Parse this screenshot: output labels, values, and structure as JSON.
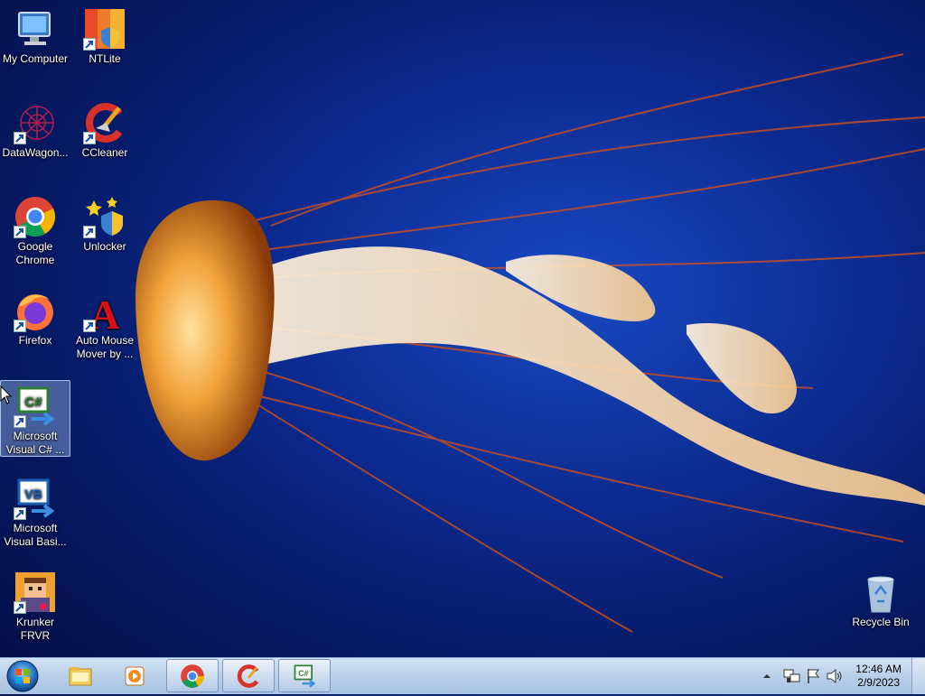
{
  "desktop": {
    "icons": [
      {
        "label": "My Computer"
      },
      {
        "label": "NTLite"
      },
      {
        "label": "DataWagon..."
      },
      {
        "label": "CCleaner"
      },
      {
        "label": "Google Chrome"
      },
      {
        "label": "Unlocker"
      },
      {
        "label": "Firefox"
      },
      {
        "label": "Auto Mouse Mover by ..."
      },
      {
        "label": "Microsoft Visual C# ..."
      },
      {
        "label": "Microsoft Visual Basi..."
      },
      {
        "label": "Krunker FRVR"
      },
      {
        "label": "Recycle Bin"
      }
    ],
    "wallpaper": "jellyfish"
  },
  "taskbar": {
    "start": {
      "icon": "windows-start-orb"
    },
    "pinned": [
      {
        "icon": "explorer-folder-icon"
      },
      {
        "icon": "media-player-icon"
      },
      {
        "icon": "chrome-icon"
      },
      {
        "icon": "ccleaner-icon"
      },
      {
        "icon": "visual-csharp-icon"
      }
    ],
    "tray": {
      "icons": [
        "show-hidden-icons-arrow",
        "network-icon",
        "action-center-flag-icon",
        "volume-icon"
      ]
    },
    "clock": {
      "time": "12:46 AM",
      "date": "2/9/2023"
    }
  },
  "colors": {
    "background_dark": "#050f45",
    "background_mid": "#1a49c4",
    "taskbar": "#b9cfe8",
    "selection": "#96b4e6"
  }
}
